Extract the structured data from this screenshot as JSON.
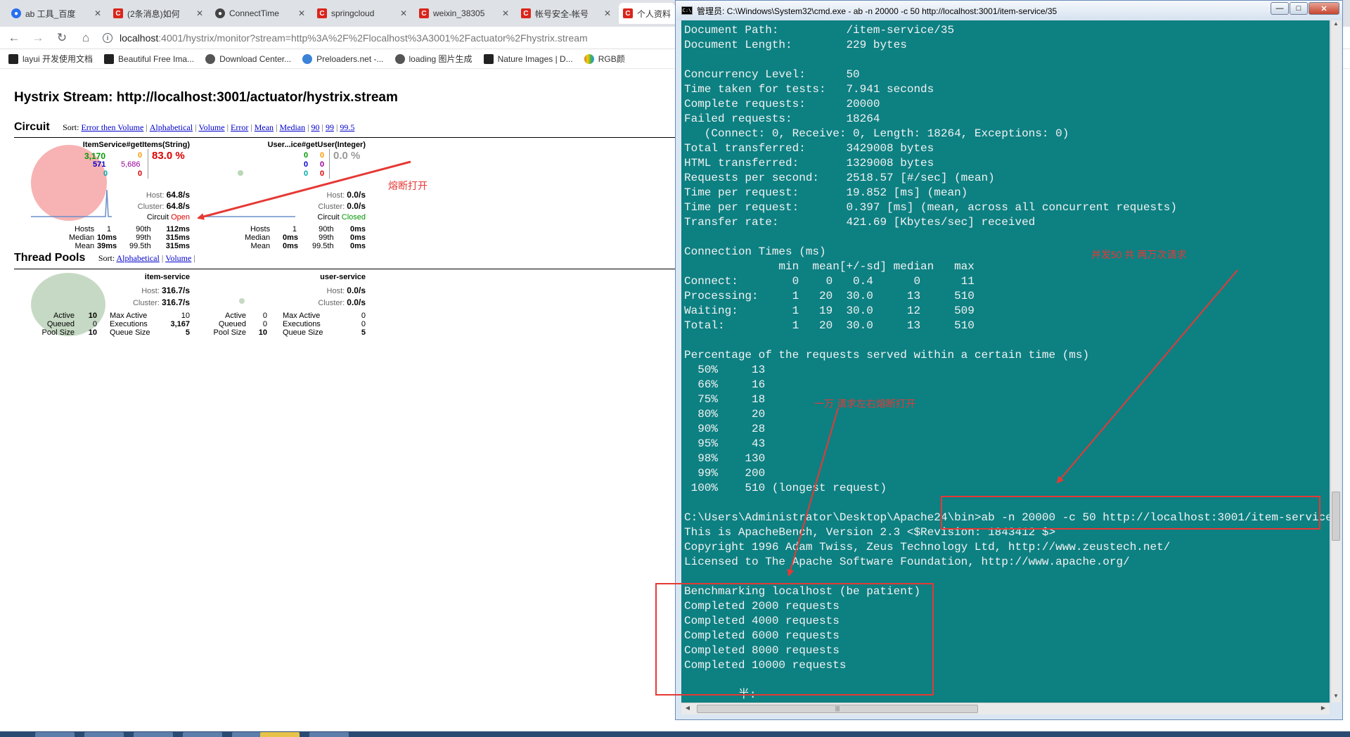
{
  "browser": {
    "tabs": [
      {
        "label": "ab 工具_百度",
        "icon": "baidu-icon",
        "active": false
      },
      {
        "label": "(2条消息)如何",
        "icon": "csdn-icon",
        "active": false
      },
      {
        "label": "ConnectTime",
        "icon": "github-icon",
        "active": false
      },
      {
        "label": "springcloud",
        "icon": "csdn-icon",
        "active": false
      },
      {
        "label": "weixin_38305",
        "icon": "csdn-icon",
        "active": false
      },
      {
        "label": "帐号安全-帐号",
        "icon": "csdn-icon",
        "active": false
      },
      {
        "label": "个人资料",
        "icon": "csdn-icon",
        "active": false
      }
    ],
    "url_host": "localhost",
    "url_rest": ":4001/hystrix/monitor?stream=http%3A%2F%2Flocalhost%3A3001%2Factuator%2Fhystrix.stream",
    "bookmarks": [
      {
        "label": "layui 开发使用文档",
        "color": "#222222"
      },
      {
        "label": "Beautiful Free Ima...",
        "color": "#222222"
      },
      {
        "label": "Download Center...",
        "color": "#555555"
      },
      {
        "label": "Preloaders.net -...",
        "color": "#3b83d6"
      },
      {
        "label": "loading 图片生成",
        "color": "#555555"
      },
      {
        "label": "Nature Images | D...",
        "color": "#222222"
      },
      {
        "label": "RGB颜",
        "color": "#e06c2e"
      }
    ]
  },
  "hystrix": {
    "title": "Hystrix Stream: http://localhost:3001/actuator/hystrix.stream",
    "circuit_section": {
      "name": "Circuit",
      "sort_label": "Sort:",
      "sort_links": [
        "Error then Volume",
        "Alphabetical",
        "Volume",
        "Error",
        "Mean",
        "Median",
        "90",
        "99",
        "99.5"
      ]
    },
    "thread_section": {
      "name": "Thread Pools",
      "sort_label": "Sort:",
      "sort_links": [
        "Alphabetical",
        "Volume"
      ]
    },
    "circuits": [
      {
        "name": "ItemService#getItems(String)",
        "success": "3,170",
        "short_circuited": "571",
        "bad_request": "0",
        "timeout": "0",
        "rejected": "5,686",
        "failure": "0",
        "error_pct": "83.0 %",
        "host_rate": "64.8/s",
        "cluster_rate": "64.8/s",
        "circuit_label": "Circuit",
        "circuit_state": "Open",
        "hosts": "1",
        "median": "10ms",
        "mean": "39ms",
        "p90": "112ms",
        "p99": "315ms",
        "p995": "315ms",
        "circle_color": "#f7a9a9"
      },
      {
        "name": "User...ice#getUser(Integer)",
        "success": "0",
        "short_circuited": "0",
        "bad_request": "0",
        "timeout": "0",
        "rejected": "0",
        "failure": "0",
        "error_pct": "0.0 %",
        "host_rate": "0.0/s",
        "cluster_rate": "0.0/s",
        "circuit_label": "Circuit",
        "circuit_state": "Closed",
        "hosts": "1",
        "median": "0ms",
        "mean": "0ms",
        "p90": "0ms",
        "p99": "0ms",
        "p995": "0ms",
        "circle_color": "#b9d7b9"
      }
    ],
    "thread_pools": [
      {
        "name": "item-service",
        "host_rate": "316.7/s",
        "cluster_rate": "316.7/s",
        "active": "10",
        "queued": "0",
        "pool_size": "10",
        "max_active": "10",
        "executions": "3,167",
        "queue_size": "5",
        "circle_color": "#c6d9c4"
      },
      {
        "name": "user-service",
        "host_rate": "0.0/s",
        "cluster_rate": "0.0/s",
        "active": "0",
        "queued": "0",
        "pool_size": "10",
        "max_active": "0",
        "executions": "0",
        "queue_size": "5",
        "circle_color": "#c6d9c4"
      }
    ],
    "labels": {
      "host": "Host:",
      "cluster": "Cluster:",
      "hosts": "Hosts",
      "median": "Median",
      "mean": "Mean",
      "p90": "90th",
      "p99": "99th",
      "p995": "99.5th",
      "active": "Active",
      "queued": "Queued",
      "pool_size": "Pool Size",
      "max_active": "Max Active",
      "executions": "Executions",
      "queue_size": "Queue Size"
    }
  },
  "cmd": {
    "title": "管理员: C:\\Windows\\System32\\cmd.exe - ab  -n 20000 -c 50 http://localhost:3001/item-service/35",
    "output": "Document Path:          /item-service/35\nDocument Length:        229 bytes\n\nConcurrency Level:      50\nTime taken for tests:   7.941 seconds\nComplete requests:      20000\nFailed requests:        18264\n   (Connect: 0, Receive: 0, Length: 18264, Exceptions: 0)\nTotal transferred:      3429008 bytes\nHTML transferred:       1329008 bytes\nRequests per second:    2518.57 [#/sec] (mean)\nTime per request:       19.852 [ms] (mean)\nTime per request:       0.397 [ms] (mean, across all concurrent requests)\nTransfer rate:          421.69 [Kbytes/sec] received\n\nConnection Times (ms)\n              min  mean[+/-sd] median   max\nConnect:        0    0   0.4      0      11\nProcessing:     1   20  30.0     13     510\nWaiting:        1   19  30.0     12     509\nTotal:          1   20  30.0     13     510\n\nPercentage of the requests served within a certain time (ms)\n  50%     13\n  66%     16\n  75%     18\n  80%     20\n  90%     28\n  95%     43\n  98%    130\n  99%    200\n 100%    510 (longest request)\n\nC:\\Users\\Administrator\\Desktop\\Apache24\\bin>ab -n 20000 -c 50 http://localhost:3001/item-service/35\nThis is ApacheBench, Version 2.3 <$Revision: 1843412 $>\nCopyright 1996 Adam Twiss, Zeus Technology Ltd, http://www.zeustech.net/\nLicensed to The Apache Software Foundation, http://www.apache.org/\n\nBenchmarking localhost (be patient)\nCompleted 2000 requests\nCompleted 4000 requests\nCompleted 6000 requests\nCompleted 8000 requests\nCompleted 10000 requests\n\n        半:"
  },
  "annotations": {
    "circuit_open_note": "熔断打开",
    "concurrency_note": "并发50 共 两万次请求",
    "ten_thousand_note": "一万 请求左右熔断打开",
    "color": "#e53935"
  }
}
